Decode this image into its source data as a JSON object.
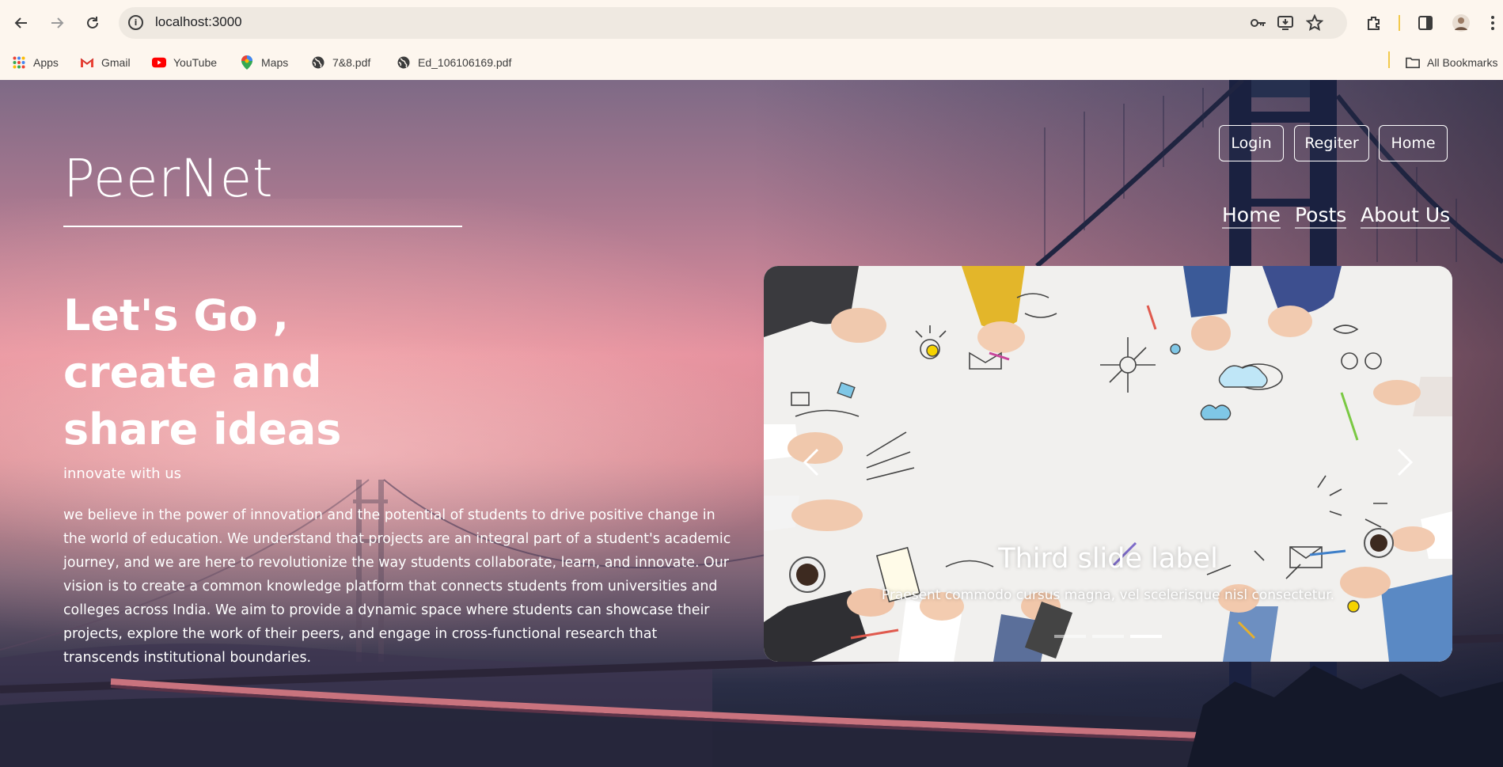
{
  "browser": {
    "url": "localhost:3000",
    "bookmarks": [
      {
        "label": "Apps",
        "icon": "apps-grid-icon"
      },
      {
        "label": "Gmail",
        "icon": "gmail-icon"
      },
      {
        "label": "YouTube",
        "icon": "youtube-icon"
      },
      {
        "label": "Maps",
        "icon": "maps-pin-icon"
      },
      {
        "label": "7&8.pdf",
        "icon": "globe-icon"
      },
      {
        "label": "Ed_106106169.pdf",
        "icon": "globe-icon"
      }
    ],
    "all_bookmarks_label": "All Bookmarks"
  },
  "header": {
    "brand": "PeerNet",
    "auth_buttons": {
      "login": "Login",
      "register": "Regiter",
      "home": "Home"
    },
    "nav": {
      "home": "Home",
      "posts": "Posts",
      "about": "About Us"
    }
  },
  "hero": {
    "line1": "Let's Go ,",
    "line2": "create and",
    "line3": "share ideas",
    "tagline": "innovate with us",
    "description": "we believe in the power of innovation and the potential of students to drive positive change in the world of education. We understand that projects are an integral part of a student's academic journey, and we are here to revolutionize the way students collaborate, learn, and innovate. Our vision is to create a common knowledge platform that connects students from universities and colleges across India. We aim to provide a dynamic space where students can showcase their projects, explore the work of their peers, and engage in cross-functional research that transcends institutional boundaries."
  },
  "carousel": {
    "caption_title": "Third slide label",
    "caption_text": "Praesent commodo cursus magna, vel scelerisque nisl consectetur.",
    "slide_count": 3,
    "active_slide": 3
  },
  "colors": {
    "chrome_bg": "#fdf6ee",
    "omnibox_bg": "#efe9e1",
    "text_white": "#ffffff"
  }
}
